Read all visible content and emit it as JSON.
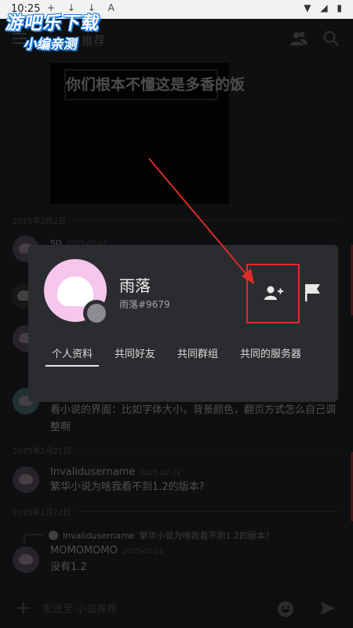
{
  "status_bar": {
    "time": "10:25",
    "notif_icons": "+ ↓ ↓ A"
  },
  "watermark": {
    "line1": "游吧乐下载",
    "line2": "小编亲测"
  },
  "top_bar": {
    "title": "推荐"
  },
  "image_message": {
    "caption": "你们根本不懂这是多香的饭"
  },
  "dates": {
    "d1": "2025年2月2日",
    "d2": "2025年2月21日",
    "d3": "2025年2月22日"
  },
  "partial_message": {
    "author": "so",
    "time": "2025-02-02"
  },
  "message_1": {
    "text": "看小说的界面：比如字体大小，背景颜色，翻页方式怎么自己调整啊"
  },
  "message_2": {
    "author": "Invalidusername",
    "time": "2025-02-21",
    "text": "繁华小说为啥我看不到1.2的版本?"
  },
  "reply_preview": {
    "author": "Invalidusername",
    "text": "繁华小说为啥我看不到1.2的版本?"
  },
  "message_3": {
    "author": "MOMOMOMO",
    "time": "2025-02-22",
    "text": "没有1.2"
  },
  "input_bar": {
    "placeholder": "发送至 小说推荐"
  },
  "popup": {
    "username": "雨落",
    "tag": "雨落#9679",
    "tabs": [
      "个人资料",
      "共同好友",
      "共同群组",
      "共同的服务器"
    ],
    "active_tab": 0
  },
  "icons": [
    "menu-icon",
    "people-icon",
    "search-icon",
    "add-friend-icon",
    "flag-icon",
    "plus-icon",
    "emoji-icon",
    "send-icon"
  ],
  "colors": {
    "highlight_red": "#e02a2a",
    "avatar_pink": "#f6c6ec",
    "background": "#1b1c1e",
    "popup_bg": "#2b2c2f"
  }
}
